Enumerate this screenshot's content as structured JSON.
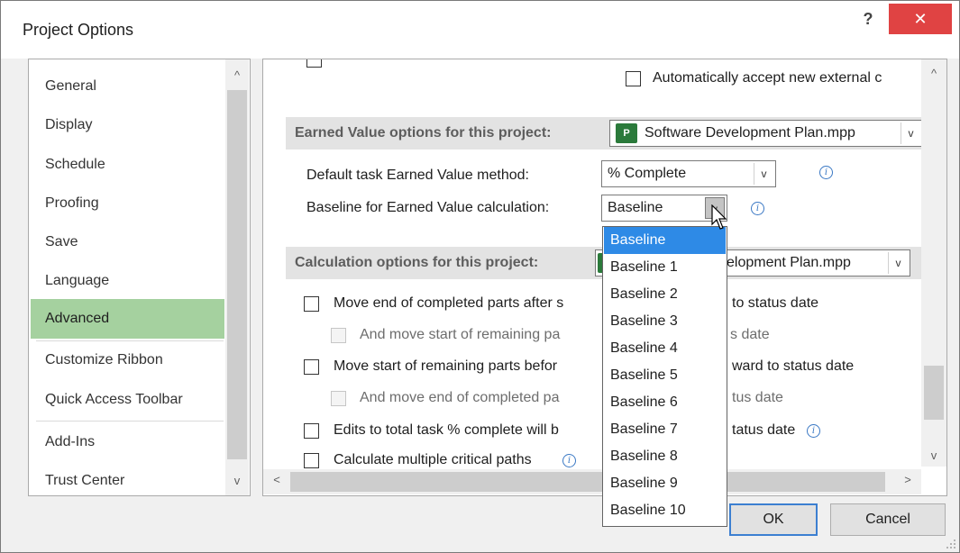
{
  "window": {
    "title": "Project Options",
    "help_label": "?",
    "close_label": "✕"
  },
  "nav": {
    "items": [
      {
        "label": "General"
      },
      {
        "label": "Display"
      },
      {
        "label": "Schedule"
      },
      {
        "label": "Proofing"
      },
      {
        "label": "Save"
      },
      {
        "label": "Language"
      },
      {
        "label": "Advanced",
        "selected": true
      },
      {
        "label": "Customize Ribbon"
      },
      {
        "label": "Quick Access Toolbar"
      },
      {
        "label": "Add-Ins"
      },
      {
        "label": "Trust Center"
      }
    ],
    "scroll_up": "^",
    "scroll_down": "v"
  },
  "content": {
    "top_checkbox_label": "Automatically accept new external c",
    "earned_value": {
      "section_label": "Earned Value options for this project:",
      "project_combo": "Software Development Plan.mpp",
      "method_label": "Default task Earned Value method:",
      "method_value": "% Complete",
      "baseline_label": "Baseline for Earned Value calculation:",
      "baseline_value": "Baseline"
    },
    "calculation": {
      "section_label": "Calculation options for this project:",
      "project_combo_visible": "elopment Plan.mpp",
      "options": [
        {
          "label": "Move end of completed parts after s",
          "tail": "to status date",
          "checked": false,
          "disabled": false
        },
        {
          "label": "And move start of remaining pa",
          "tail": "s date",
          "checked": false,
          "disabled": true
        },
        {
          "label": "Move start of remaining parts befor",
          "tail": "ward to status date",
          "checked": false,
          "disabled": false
        },
        {
          "label": "And move end of completed pa",
          "tail": "tus date",
          "checked": false,
          "disabled": true
        },
        {
          "label": "Edits to total task % complete will b",
          "tail": "tatus date",
          "checked": false,
          "disabled": false
        },
        {
          "label": "Calculate multiple critical paths",
          "tail": "",
          "checked": false,
          "disabled": false
        }
      ]
    },
    "info_glyph": "i",
    "project_icon_glyph": "P",
    "scroll_left": "<",
    "scroll_right": ">",
    "scroll_up": "^",
    "scroll_down": "v",
    "combo_arrow": "v"
  },
  "dropdown": {
    "items": [
      {
        "label": "Baseline",
        "selected": true
      },
      {
        "label": "Baseline 1"
      },
      {
        "label": "Baseline 2"
      },
      {
        "label": "Baseline 3"
      },
      {
        "label": "Baseline 4"
      },
      {
        "label": "Baseline 5"
      },
      {
        "label": "Baseline 6"
      },
      {
        "label": "Baseline 7"
      },
      {
        "label": "Baseline 8"
      },
      {
        "label": "Baseline 9"
      },
      {
        "label": "Baseline 10"
      }
    ]
  },
  "buttons": {
    "ok": "OK",
    "cancel": "Cancel"
  },
  "colors": {
    "close_button": "#e04343",
    "nav_selected": "#a5d19f",
    "dropdown_selected": "#2e8ae6",
    "section_bar": "#e3e3e3"
  }
}
